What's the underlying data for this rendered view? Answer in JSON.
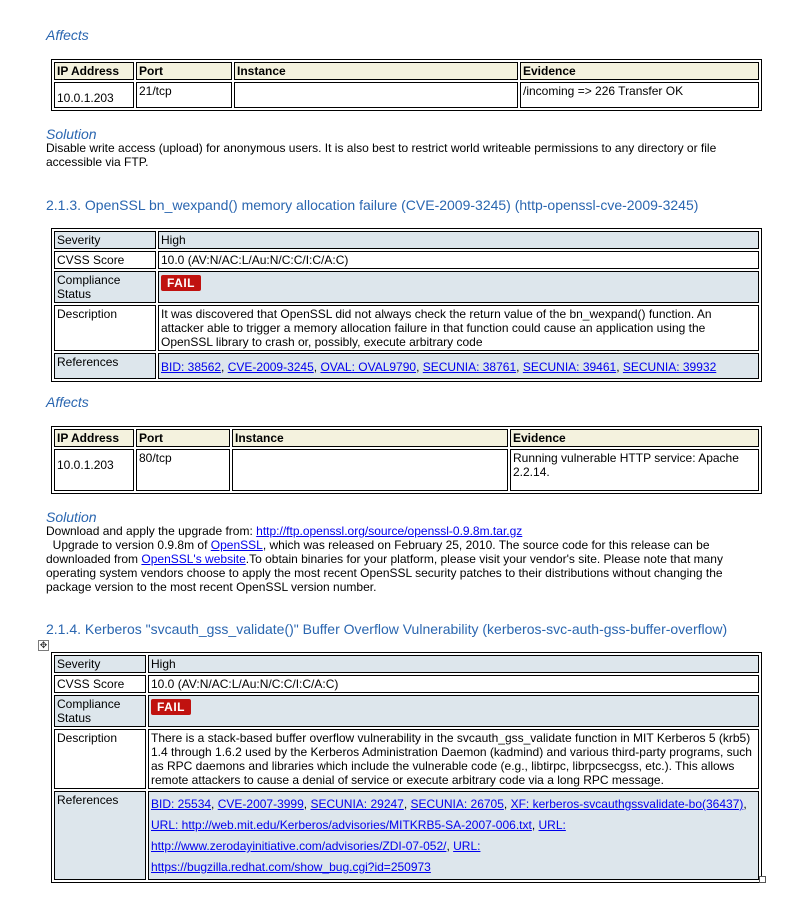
{
  "s1": {
    "affects_label": "Affects",
    "headers": [
      "IP Address",
      "Port",
      "Instance",
      "Evidence"
    ],
    "row": [
      "10.0.1.203",
      "21/tcp",
      "",
      "/incoming => 226 Transfer OK"
    ],
    "solution_label": "Solution",
    "solution_text": " Disable write access (upload) for anonymous users. It is also best to restrict world writeable permissions to any directory or file accessible via FTP."
  },
  "s2": {
    "title": "2.1.3. OpenSSL bn_wexpand() memory allocation failure (CVE-2009-3245)  (http-openssl-cve-2009-3245)",
    "severity_label": "Severity",
    "severity": "High",
    "cvss_label": "CVSS Score",
    "cvss": "10.0 (AV:N/AC:L/Au:N/C:C/I:C/A:C)",
    "compliance_label": "Compliance Status",
    "compliance": "FAIL",
    "description_label": "Description",
    "description": " It was discovered that OpenSSL did not always check the return value of the bn_wexpand() function. An attacker able to trigger a memory allocation failure in that function could cause an application using the OpenSSL library to crash or, possibly, execute arbitrary code",
    "references_label": "References",
    "references": [
      "BID: 38562",
      "CVE-2009-3245",
      "OVAL: OVAL9790",
      "SECUNIA: 38761",
      "SECUNIA: 39461",
      "SECUNIA: 39932"
    ],
    "affects_label": "Affects",
    "headers": [
      "IP Address",
      "Port",
      "Instance",
      "Evidence"
    ],
    "row": [
      "10.0.1.203",
      "80/tcp",
      "",
      "Running vulnerable HTTP service: Apache 2.2.14."
    ],
    "solution_label": "Solution",
    "sol_line1_prefix": "Download and apply the upgrade from: ",
    "sol_line1_link": "http://ftp.openssl.org/source/openssl-0.9.8m.tar.gz",
    "sol_p2_a": "  Upgrade to version 0.9.8m of ",
    "sol_p2_link1": "OpenSSL",
    "sol_p2_b": ", which was released on February 25, 2010. The source code for this release can be downloaded from ",
    "sol_p2_link2": "OpenSSL's website",
    "sol_p2_c": ".To obtain binaries for your platform, please visit your vendor's site. Please note that many operating system vendors choose to apply the  most recent OpenSSL security patches to their distributions without changing the package version to the most recent OpenSSL version number."
  },
  "s3": {
    "title": "2.1.4. Kerberos \"svcauth_gss_validate()\" Buffer Overflow Vulnerability (kerberos-svc-auth-gss-buffer-overflow)",
    "severity_label": "Severity",
    "severity": "High",
    "cvss_label": "CVSS Score",
    "cvss": "10.0 (AV:N/AC:L/Au:N/C:C/I:C/A:C)",
    "compliance_label": "Compliance Status",
    "compliance": "FAIL",
    "description_label": "Description",
    "description": " There is a stack-based buffer overflow vulnerability in the svcauth_gss_validate function in MIT Kerberos 5 (krb5) 1.4 through 1.6.2 used by the Kerberos Administration Daemon (kadmind) and various third-party programs, such as RPC daemons and libraries which include the vulnerable code (e.g., libtirpc, librpcsecgss, etc.). This allows remote attackers to cause a denial of service or execute arbitrary code via a long RPC message.",
    "references_label": "References",
    "ref_l1": [
      "BID: 25534",
      "CVE-2007-3999",
      "SECUNIA: 29247",
      "SECUNIA: 26705",
      "XF: kerberos-svcauthgssvalidate-bo(36437)"
    ],
    "ref_l2": [
      "URL: http://web.mit.edu/Kerberos/advisories/MITKRB5-SA-2007-006.txt",
      "URL:"
    ],
    "ref_l3": [
      "http://www.zerodayinitiative.com/advisories/ZDI-07-052/",
      "URL:"
    ],
    "ref_l4": "https://bugzilla.redhat.com/show_bug.cgi?id=250973"
  },
  "icons": {
    "move_anchor": "move-anchor-icon",
    "resize_handle": "resize-handle-icon"
  },
  "colors": {
    "heading": "#2a66b0",
    "fail": "#c0120f",
    "link": "#0000ee",
    "table_header": "#f4f2de",
    "shaded_cell": "#dde6ec"
  }
}
